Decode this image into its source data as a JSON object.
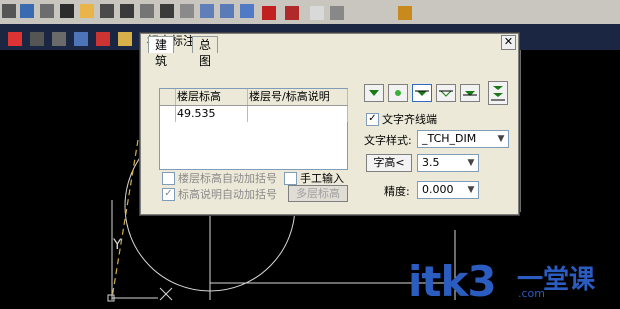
{
  "dialog": {
    "title": "标高标注",
    "close_label": "✕",
    "tabs": [
      {
        "label": "建筑",
        "active": true
      },
      {
        "label": "总图",
        "active": false
      }
    ],
    "grid": {
      "headers": [
        "楼层标高",
        "楼层号/标高说明"
      ],
      "rows": [
        {
          "level": "49.535",
          "note": ""
        }
      ]
    },
    "options": {
      "auto_floor_bracket": {
        "label": "楼层标高自动加括号",
        "checked": false,
        "enabled": false
      },
      "auto_note_bracket": {
        "label": "标高说明自动加括号",
        "checked": true,
        "enabled": false
      },
      "manual_input": {
        "label": "手工输入",
        "checked": false,
        "enabled": true
      },
      "multi_level_label": "多层标高"
    },
    "style": {
      "text_align_end": {
        "label": "文字齐线端",
        "checked": true
      },
      "text_style_label": "文字样式:",
      "text_style_value": "_TCH_DIM",
      "text_height_button": "字高<",
      "text_height_value": "3.5",
      "precision_label": "精度:",
      "precision_value": "0.000"
    }
  },
  "cad": {
    "label_y": "Y"
  },
  "watermark": {
    "main": "itk3",
    "right_top": "一堂课",
    "right_bottom": ".com"
  },
  "colors": {
    "dialog_bg": "#ece9d8",
    "toolbar_bg": "#1b2642",
    "watermark": "#2b5cbf"
  }
}
